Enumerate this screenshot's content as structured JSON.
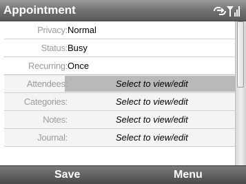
{
  "title_bar": {
    "title": "Appointment",
    "icons": [
      "data-connection-icon",
      "signal-strength-icon"
    ]
  },
  "fields": [
    {
      "label": "Privacy:",
      "value": "Normal"
    },
    {
      "label": "Status:",
      "value": "Busy"
    },
    {
      "label": "Recurring:",
      "value": "Once"
    },
    {
      "label": "Attendees:",
      "value": "Select to view/edit",
      "selected": true
    },
    {
      "label": "Categories:",
      "value": "Select to view/edit"
    },
    {
      "label": "Notes:",
      "value": "Select to view/edit"
    },
    {
      "label": "Journal:",
      "value": "Select to view/edit"
    }
  ],
  "softkeys": {
    "left": "Save",
    "right": "Menu"
  }
}
